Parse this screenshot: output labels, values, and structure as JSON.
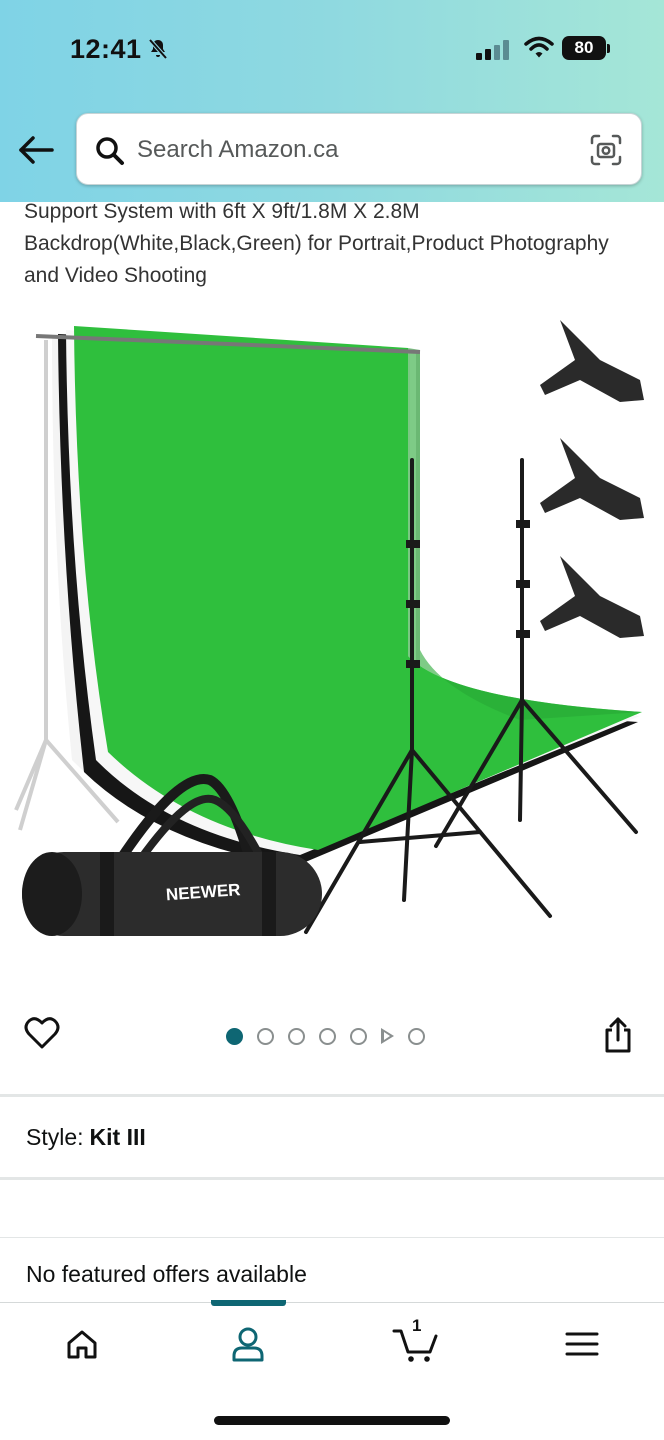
{
  "status_bar": {
    "time": "12:41",
    "battery": "80"
  },
  "search": {
    "placeholder": "Search Amazon.ca"
  },
  "product": {
    "title": "Support System with 6ft X 9ft/1.8M X 2.8M Backdrop(White,Black,Green) for Portrait,Product Photography and Video Shooting",
    "bag_brand": "NEEWER",
    "image_count": 7,
    "active_image_index": 0
  },
  "style": {
    "label": "Style:",
    "value": "Kit III"
  },
  "offers": {
    "text": "No featured offers available"
  },
  "bottom_nav": {
    "items": [
      "home",
      "account",
      "cart",
      "menu"
    ],
    "active": "account",
    "cart_count": "1"
  },
  "colors": {
    "accent": "#0e6673",
    "header_gradient_start": "#7fd3e6",
    "header_gradient_end": "#a5e6d7",
    "backdrop_green": "#2fbf3d"
  }
}
